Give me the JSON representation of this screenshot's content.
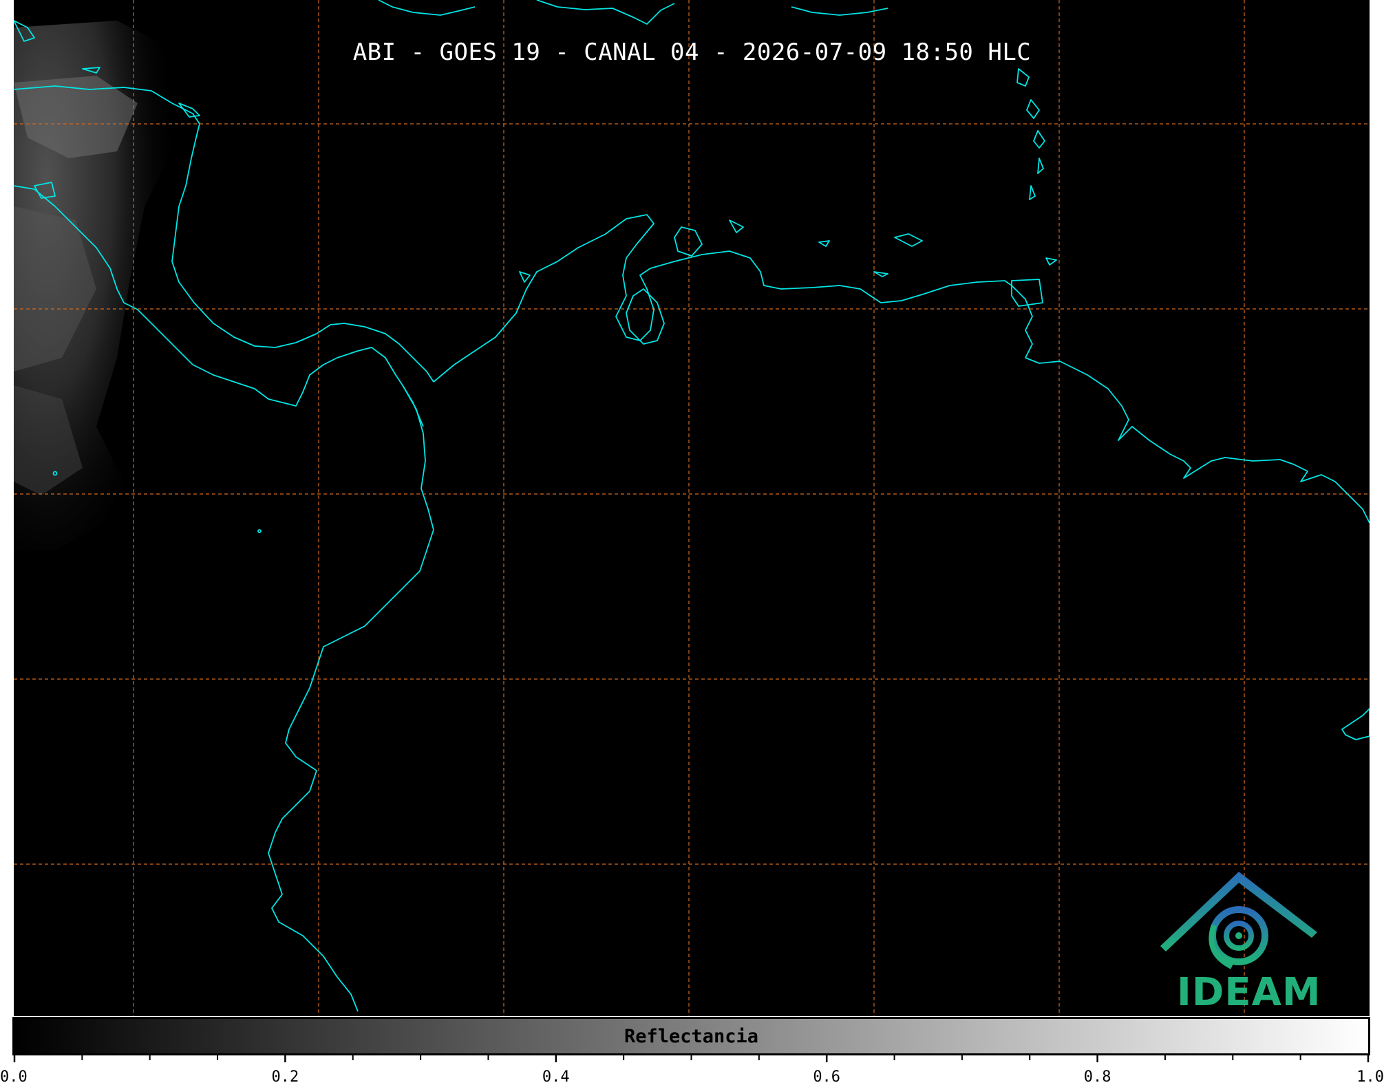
{
  "title": "ABI - GOES 19 - CANAL 04 - 2026-07-09 18:50 HLC",
  "colorbar": {
    "label": "Reflectancia",
    "range": [
      0.0,
      1.0
    ],
    "major_ticks": [
      "0.0",
      "0.2",
      "0.4",
      "0.6",
      "0.8",
      "1.0"
    ],
    "minor_tick_step": 0.05,
    "colormap": "grayscale black-to-white"
  },
  "logo": {
    "text": "IDEAM"
  },
  "colors": {
    "background": "#000000",
    "coastline": "#00e5e5",
    "graticule": "#d2691e",
    "logo_text": "#22b07a",
    "logo_gradient": [
      "#2a6db8",
      "#22b07a"
    ]
  },
  "icons": [
    "ideam-logo"
  ]
}
